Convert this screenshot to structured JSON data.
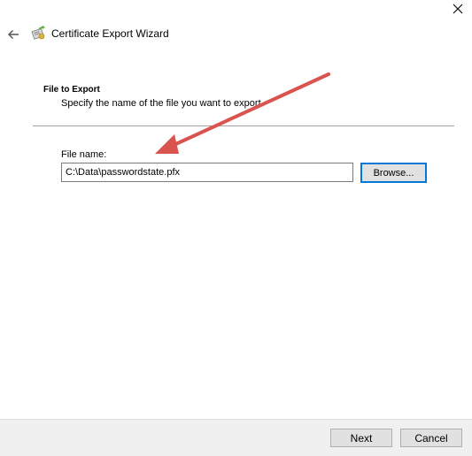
{
  "window": {
    "title": "Certificate Export Wizard",
    "close_icon": "close-icon",
    "back_icon": "back-arrow-icon",
    "wizard_icon": "certificate-wizard-icon"
  },
  "section": {
    "title": "File to Export",
    "description": "Specify the name of the file you want to export"
  },
  "file": {
    "label": "File name:",
    "value": "C:\\Data\\passwordstate.pfx",
    "browse_label": "Browse..."
  },
  "footer": {
    "next_label": "Next",
    "cancel_label": "Cancel"
  },
  "annotation": {
    "arrow_color": "#d9534f"
  },
  "colors": {
    "footer_bg": "#f0f0f0",
    "button_bg": "#e1e1e1",
    "focus_border": "#0078d7"
  }
}
